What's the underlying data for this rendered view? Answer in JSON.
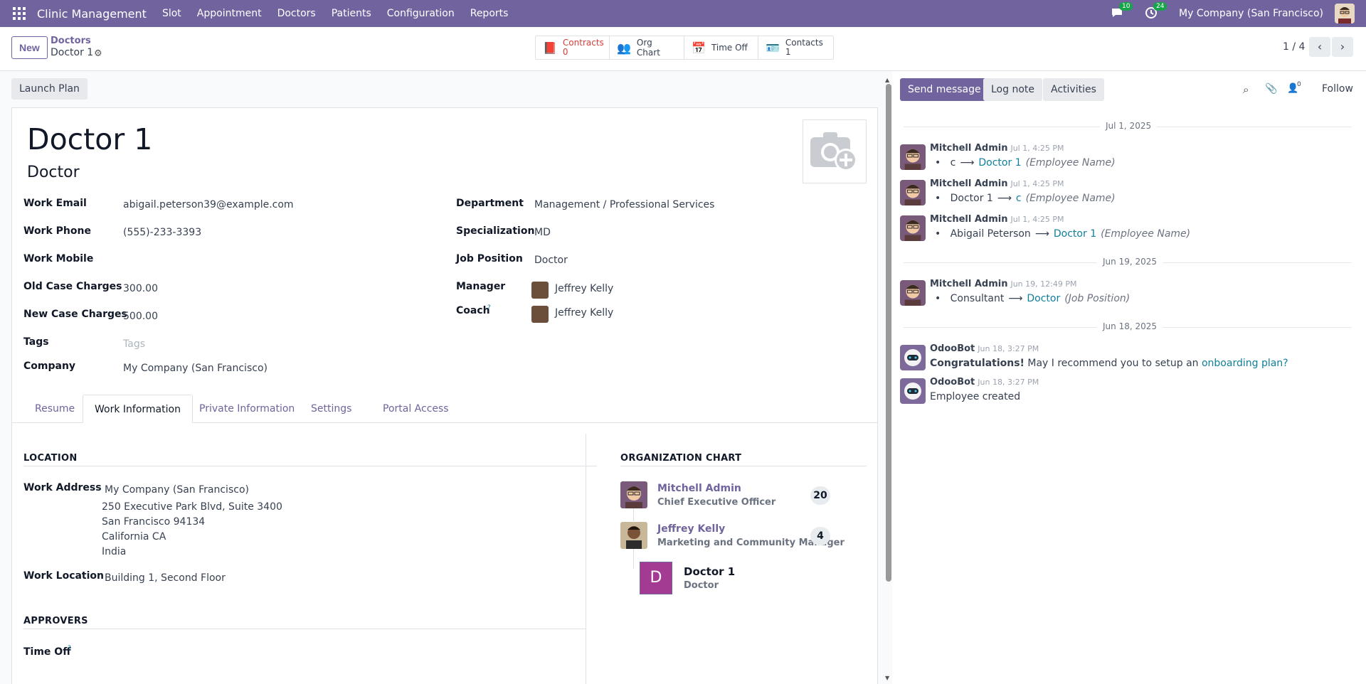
{
  "topbar": {
    "app_name": "Clinic Management",
    "menu": [
      "Slot",
      "Appointment",
      "Doctors",
      "Patients",
      "Configuration",
      "Reports"
    ],
    "messages_count": "10",
    "activities_count": "24",
    "company": "My Company (San Francisco)"
  },
  "control_panel": {
    "new_label": "New",
    "breadcrumb_parent": "Doctors",
    "breadcrumb_current": "Doctor 1",
    "smart_buttons": {
      "contracts_label": "Contracts",
      "contracts_count": "0",
      "org_chart_label": "Org Chart",
      "time_off_label": "Time Off",
      "contacts_label": "Contacts",
      "contacts_count": "1"
    },
    "pager": "1 / 4"
  },
  "form": {
    "launch_plan_label": "Launch Plan",
    "name": "Doctor 1",
    "job_title": "Doctor",
    "left_fields": {
      "work_email_label": "Work Email",
      "work_email": "abigail.peterson39@example.com",
      "work_phone_label": "Work Phone",
      "work_phone": "(555)-233-3393",
      "work_mobile_label": "Work Mobile",
      "old_case_label": "Old Case Charges",
      "old_case": "300.00",
      "new_case_label": "New Case Charges",
      "new_case": "500.00",
      "tags_label": "Tags",
      "tags_placeholder": "Tags",
      "company_label": "Company",
      "company": "My Company (San Francisco)"
    },
    "right_fields": {
      "department_label": "Department",
      "department": "Management / Professional Services",
      "specialization_label": "Specialization",
      "specialization": "MD",
      "job_position_label": "Job Position",
      "job_position": "Doctor",
      "manager_label": "Manager",
      "manager": "Jeffrey Kelly",
      "coach_label": "Coach",
      "coach_hint": "?",
      "coach": "Jeffrey Kelly"
    },
    "tabs": [
      "Resume",
      "Work Information",
      "Private Information",
      "Settings",
      "Portal Access"
    ],
    "location": {
      "heading": "LOCATION",
      "work_address_label": "Work Address",
      "address_lines": [
        "My Company (San Francisco)",
        "250 Executive Park Blvd, Suite 3400",
        "San Francisco 94134",
        "California CA",
        "India"
      ],
      "work_location_label": "Work Location",
      "work_location": "Building 1, Second Floor"
    },
    "approvers": {
      "heading": "APPROVERS",
      "time_off_label": "Time Off",
      "time_off_hint": "?"
    },
    "org_chart": {
      "heading": "ORGANIZATION CHART",
      "people": [
        {
          "name": "Mitchell Admin",
          "job": "Chief Executive Officer",
          "count": "20"
        },
        {
          "name": "Jeffrey Kelly",
          "job": "Marketing and Community Manager",
          "count": "4"
        }
      ],
      "current": {
        "initial": "D",
        "name": "Doctor 1",
        "job": "Doctor"
      }
    }
  },
  "chatter": {
    "send_message": "Send message",
    "log_note": "Log note",
    "activities": "Activities",
    "followers_count": "0",
    "follow": "Follow",
    "dates": [
      "Jul 1, 2025",
      "Jun 19, 2025",
      "Jun 18, 2025"
    ],
    "messages": [
      {
        "author": "Mitchell Admin",
        "time": "Jul 1, 4:25 PM",
        "old": "c",
        "new": "Doctor 1",
        "field": "(Employee Name)"
      },
      {
        "author": "Mitchell Admin",
        "time": "Jul 1, 4:25 PM",
        "old": "Doctor 1",
        "new": "c",
        "field": "(Employee Name)"
      },
      {
        "author": "Mitchell Admin",
        "time": "Jul 1, 4:25 PM",
        "old": "Abigail Peterson",
        "new": "Doctor 1",
        "field": "(Employee Name)"
      },
      {
        "author": "Mitchell Admin",
        "time": "Jun 19, 12:49 PM",
        "old": "Consultant",
        "new": "Doctor",
        "field": "(Job Position)"
      }
    ],
    "bot_messages": [
      {
        "author": "OdooBot",
        "time": "Jun 18, 3:27 PM",
        "bold": "Congratulations!",
        "text": " May I recommend you to setup an ",
        "link": "onboarding plan?"
      },
      {
        "author": "OdooBot",
        "time": "Jun 18, 3:27 PM",
        "text": "Employee created"
      }
    ],
    "colors": {
      "accent": "#71639e",
      "link": "#0f7e99"
    }
  }
}
